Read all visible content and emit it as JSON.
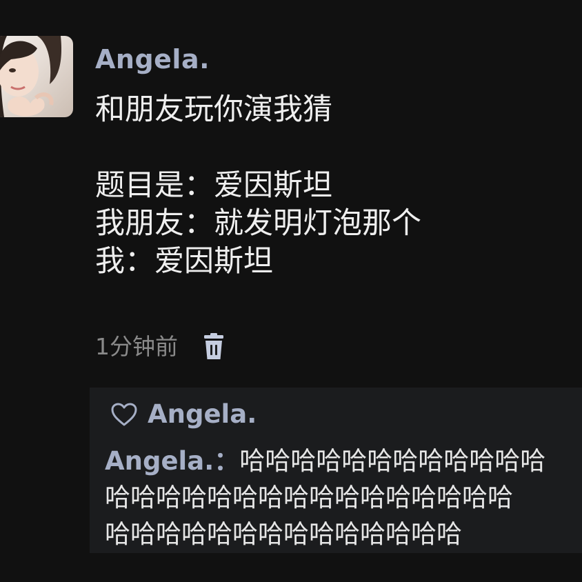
{
  "post": {
    "author": "Angela.",
    "lines": [
      "和朋友玩你演我猜",
      "",
      "题目是：爱因斯坦",
      "我朋友：就发明灯泡那个",
      "我：爱因斯坦"
    ],
    "time": "1分钟前",
    "icons": {
      "avatar": "avatar-photo",
      "delete": "trash-icon"
    }
  },
  "likes": {
    "icon": "heart-icon",
    "names": [
      "Angela."
    ]
  },
  "comment": {
    "author": "Angela.",
    "separator": "：",
    "lines": [
      "哈哈哈哈哈哈哈哈哈哈哈哈",
      "哈哈哈哈哈哈哈哈哈哈哈哈哈哈哈哈",
      "哈哈哈哈哈哈哈哈哈哈哈哈哈哈"
    ]
  },
  "colors": {
    "background": "#111111",
    "name_accent": "#a6afc6",
    "text": "#efefef",
    "muted": "#8a8a8a",
    "panel": "#1b1c1e"
  }
}
